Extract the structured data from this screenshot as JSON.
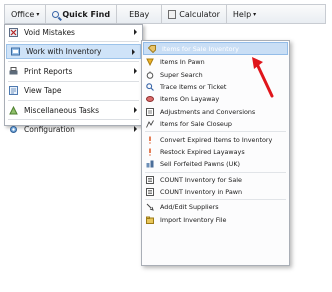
{
  "menubar": {
    "office": "Office",
    "office_caret": "▾",
    "quick_find": "Quick Find",
    "ebay": "EBay",
    "calculator": "Calculator",
    "help": "Help",
    "help_caret": "▾"
  },
  "menu": {
    "items": [
      {
        "label": "Void Mistakes",
        "icon": "void-icon"
      },
      {
        "label": "Work with Inventory",
        "icon": "inventory-icon"
      },
      {
        "label": "Print Reports",
        "icon": "printer-icon"
      },
      {
        "label": "View Tape",
        "icon": "tape-icon"
      },
      {
        "label": "Miscellaneous Tasks",
        "icon": "tasks-icon"
      },
      {
        "label": "Configuration",
        "icon": "configuration-icon"
      }
    ]
  },
  "submenu": {
    "items": [
      {
        "label": "Items for Sale Inventory",
        "icon": "items-for-sale-icon"
      },
      {
        "label": "Items In Pawn",
        "icon": "pawn-icon"
      },
      {
        "label": "Super Search",
        "icon": "super-search-icon"
      },
      {
        "label": "Trace Items or Ticket",
        "icon": "trace-icon"
      },
      {
        "label": "Items On Layaway",
        "icon": "layaway-icon"
      },
      {
        "label": "Adjustments and Conversions",
        "icon": "adjustments-icon"
      },
      {
        "label": "Items for Sale Closeup",
        "icon": "closeup-icon"
      },
      {
        "label": "Convert Expired Items to Inventory",
        "icon": "convert-icon"
      },
      {
        "label": "Restock Expired Layaways",
        "icon": "restock-icon"
      },
      {
        "label": "Sell Forfeited Pawns (UK)",
        "icon": "forfeited-icon"
      },
      {
        "label": "COUNT Inventory for Sale",
        "icon": "count-sale-icon"
      },
      {
        "label": "COUNT Inventory in Pawn",
        "icon": "count-pawn-icon"
      },
      {
        "label": "Add/Edit Suppliers",
        "icon": "suppliers-icon"
      },
      {
        "label": "Import Inventory File",
        "icon": "import-icon"
      }
    ]
  },
  "colors": {
    "highlight": "#c9def5",
    "annotation_arrow": "#e0151b"
  }
}
